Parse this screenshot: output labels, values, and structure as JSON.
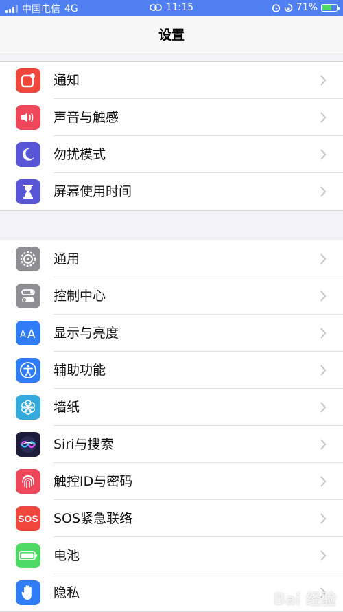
{
  "status_bar": {
    "carrier": "中国电信",
    "network": "4G",
    "time": "11:15",
    "battery_percent": "71%",
    "battery_level": 0.71
  },
  "nav": {
    "title": "设置"
  },
  "groups": [
    {
      "items": [
        {
          "label": "通知",
          "icon": "notification-icon",
          "color": "#f0463c"
        },
        {
          "label": "声音与触感",
          "icon": "sound-icon",
          "color": "#f0465a"
        },
        {
          "label": "勿扰模式",
          "icon": "moon-icon",
          "color": "#5856d6"
        },
        {
          "label": "屏幕使用时间",
          "icon": "hourglass-icon",
          "color": "#5856d6"
        }
      ]
    },
    {
      "items": [
        {
          "label": "通用",
          "icon": "gear-icon",
          "color": "#8e8e93"
        },
        {
          "label": "控制中心",
          "icon": "toggle-icon",
          "color": "#8e8e93"
        },
        {
          "label": "显示与亮度",
          "icon": "text-size-icon",
          "color": "#2f7cf6"
        },
        {
          "label": "辅助功能",
          "icon": "accessibility-icon",
          "color": "#2f7cf6"
        },
        {
          "label": "墙纸",
          "icon": "flower-icon",
          "color": "#35aadc"
        },
        {
          "label": "Siri与搜索",
          "icon": "siri-icon",
          "color": "#1c1c3a"
        },
        {
          "label": "触控ID与密码",
          "icon": "fingerprint-icon",
          "color": "#f0465a"
        },
        {
          "label": "SOS紧急联络",
          "icon": "sos-icon",
          "color": "#f0463c"
        },
        {
          "label": "电池",
          "icon": "battery-icon",
          "color": "#4cd964"
        },
        {
          "label": "隐私",
          "icon": "hand-icon",
          "color": "#2f7cf6"
        }
      ]
    }
  ],
  "watermark": "Bai 经验"
}
